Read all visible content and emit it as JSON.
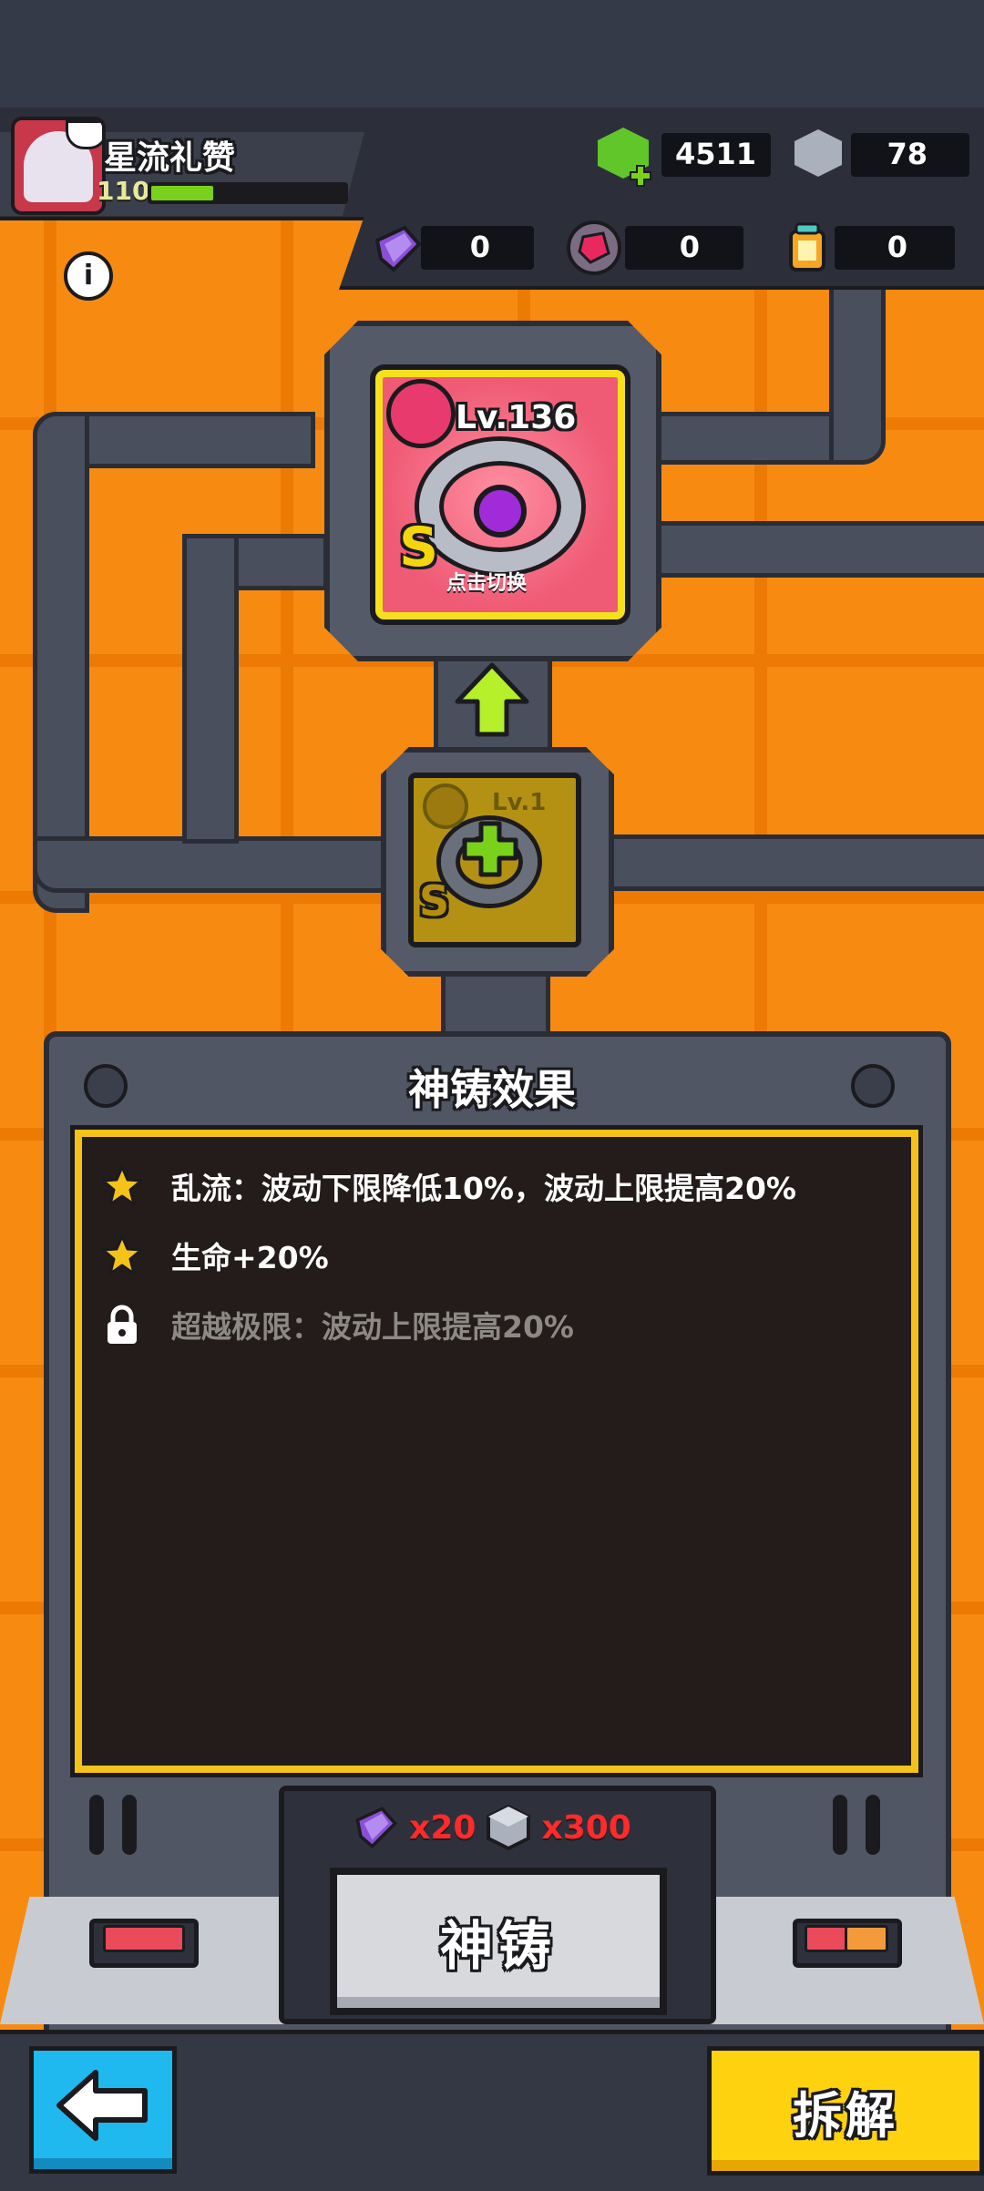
{
  "player": {
    "name": "星流礼赞",
    "level": "110",
    "xp_fraction": 0.32
  },
  "currencies": {
    "gems": "4511",
    "cubes": "78"
  },
  "resources": [
    {
      "icon": "purple-shard-icon",
      "value": "0"
    },
    {
      "icon": "red-crystal-icon",
      "value": "0"
    },
    {
      "icon": "lantern-icon",
      "value": "0"
    }
  ],
  "equipment": {
    "current": {
      "level": "Lv.136",
      "rank": "S",
      "switch_hint": "点击切换"
    },
    "material": {
      "level": "Lv.1",
      "rank": "S"
    }
  },
  "panel": {
    "title": "神铸效果",
    "effects": [
      {
        "text": "乱流：波动下限降低10%，波动上限提高20%",
        "state": "unlocked"
      },
      {
        "text": "生命+20%",
        "state": "unlocked"
      },
      {
        "text": "超越极限：波动上限提高20%",
        "state": "locked"
      }
    ]
  },
  "forge": {
    "cost_shard": "x20",
    "cost_cube": "x300",
    "button_label": "神铸"
  },
  "actions": {
    "dismantle_label": "拆解"
  },
  "colors": {
    "background": "#f78b11",
    "accent_yellow": "#ffd20f",
    "back_blue": "#1fb8ef",
    "cost_red": "#ff2a2a"
  }
}
